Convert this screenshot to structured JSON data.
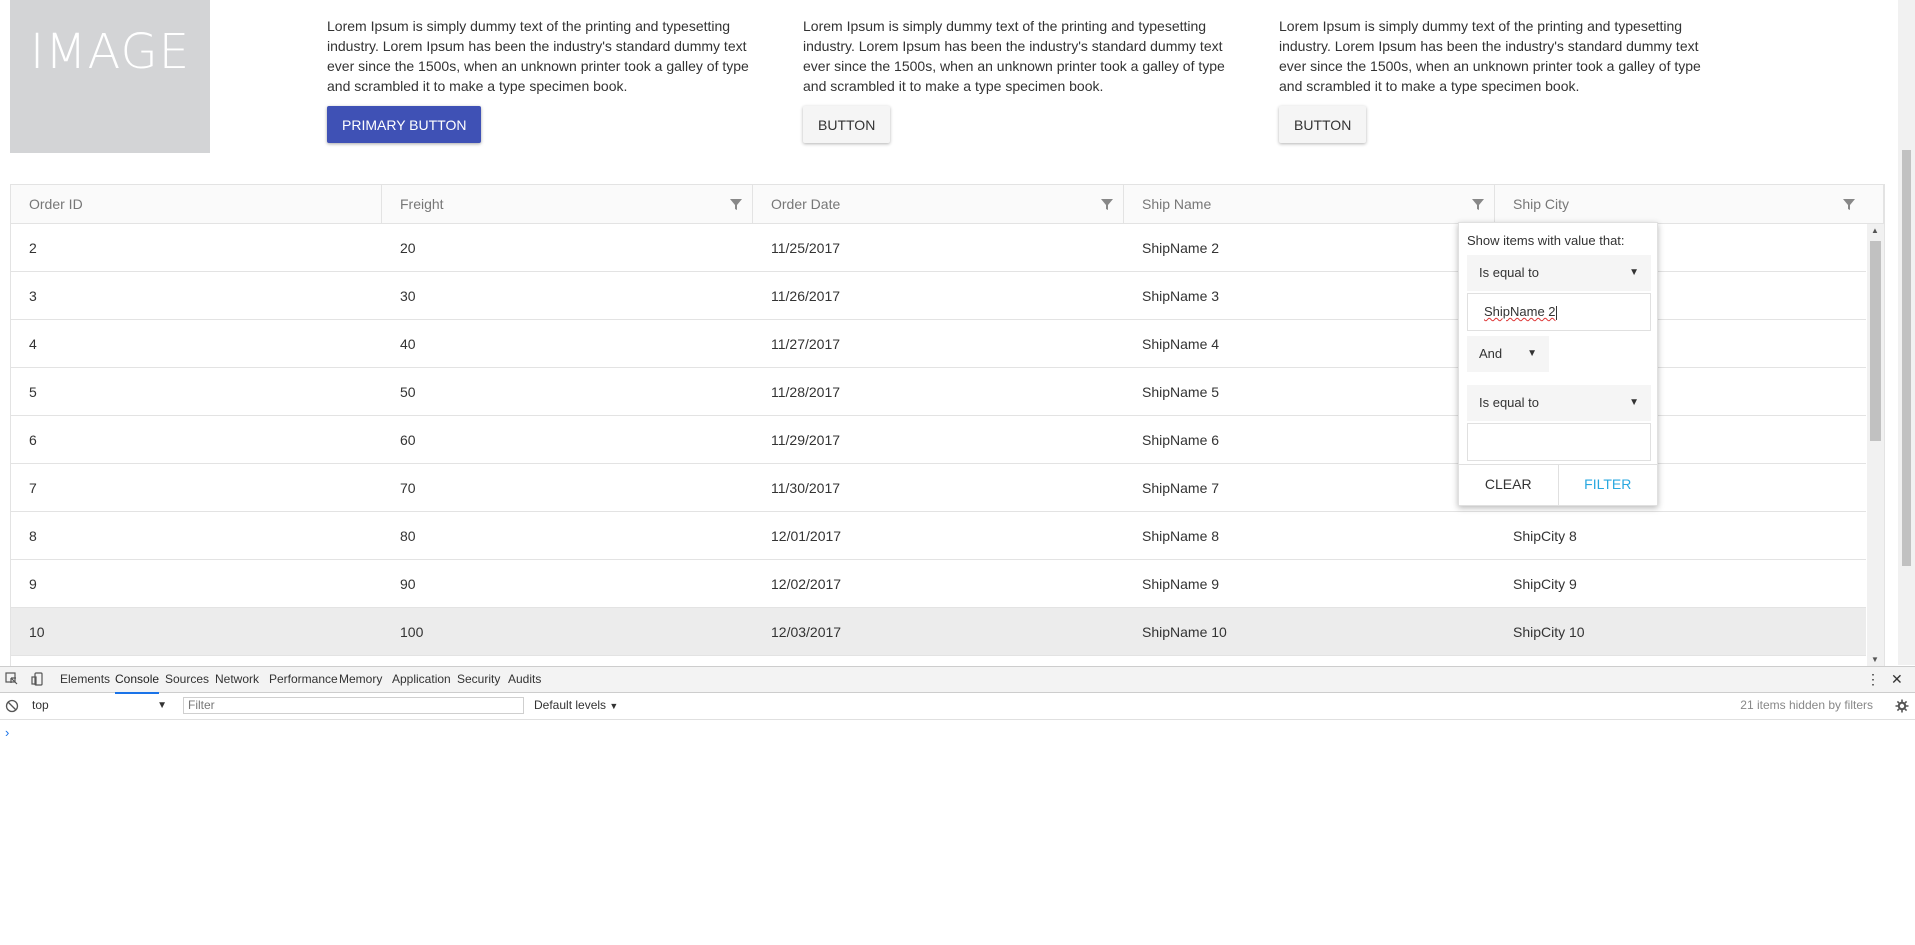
{
  "hero": {
    "image_label": "IMAGE"
  },
  "cards": [
    {
      "text": "Lorem Ipsum is simply dummy text of the printing and typesetting industry. Lorem Ipsum has been the industry's standard dummy text ever since the 1500s, when an unknown printer took a galley of type and scrambled it to make a type specimen book.",
      "button": "PRIMARY BUTTON"
    },
    {
      "text": "Lorem Ipsum is simply dummy text of the printing and typesetting industry. Lorem Ipsum has been the industry's standard dummy text ever since the 1500s, when an unknown printer took a galley of type and scrambled it to make a type specimen book.",
      "button": "BUTTON"
    },
    {
      "text": "Lorem Ipsum is simply dummy text of the printing and typesetting industry. Lorem Ipsum has been the industry's standard dummy text ever since the 1500s, when an unknown printer took a galley of type and scrambled it to make a type specimen book.",
      "button": "BUTTON"
    }
  ],
  "grid": {
    "columns": [
      "Order ID",
      "Freight",
      "Order Date",
      "Ship Name",
      "Ship City"
    ],
    "rows": [
      [
        "2",
        "20",
        "11/25/2017",
        "ShipName 2",
        ""
      ],
      [
        "3",
        "30",
        "11/26/2017",
        "ShipName 3",
        ""
      ],
      [
        "4",
        "40",
        "11/27/2017",
        "ShipName 4",
        ""
      ],
      [
        "5",
        "50",
        "11/28/2017",
        "ShipName 5",
        ""
      ],
      [
        "6",
        "60",
        "11/29/2017",
        "ShipName 6",
        ""
      ],
      [
        "7",
        "70",
        "11/30/2017",
        "ShipName 7",
        ""
      ],
      [
        "8",
        "80",
        "12/01/2017",
        "ShipName 8",
        "ShipCity 8"
      ],
      [
        "9",
        "90",
        "12/02/2017",
        "ShipName 9",
        "ShipCity 9"
      ],
      [
        "10",
        "100",
        "12/03/2017",
        "ShipName 10",
        "ShipCity 10"
      ]
    ],
    "selected_row_index": 8
  },
  "filter_popup": {
    "title": "Show items with value that:",
    "operator1": "Is equal to",
    "value1": "ShipName 2",
    "logic": "And",
    "operator2": "Is equal to",
    "value2": "",
    "clear_label": "CLEAR",
    "filter_label": "FILTER"
  },
  "devtools": {
    "tabs": [
      "Elements",
      "Console",
      "Sources",
      "Network",
      "Performance",
      "Memory",
      "Application",
      "Security",
      "Audits"
    ],
    "active_tab": "Console",
    "context": "top",
    "filter_placeholder": "Filter",
    "levels": "Default levels",
    "hidden_info": "21 items hidden by filters",
    "prompt": "›"
  },
  "colors": {
    "primary_button": "#3f51b5",
    "filter_action": "#29a8e0",
    "active_tab_underline": "#1a73e8"
  }
}
